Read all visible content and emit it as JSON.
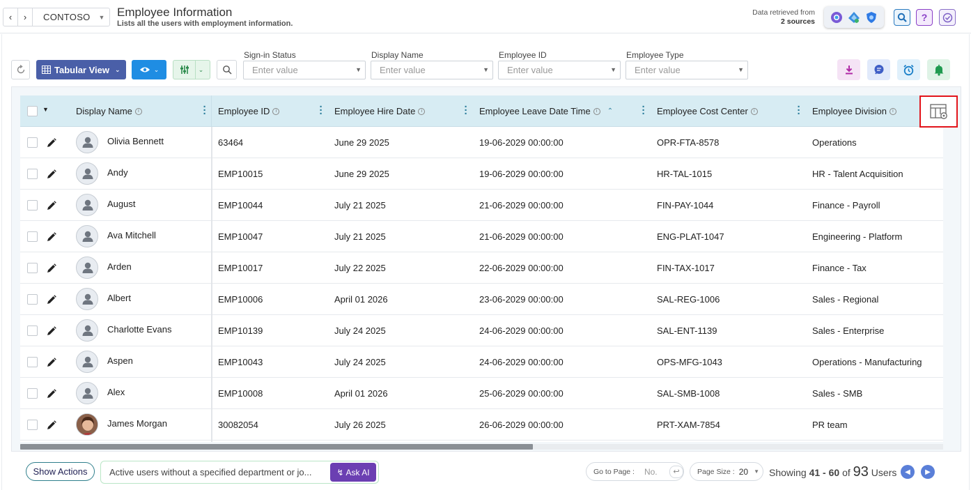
{
  "header": {
    "tenant": "CONTOSO",
    "title": "Employee Information",
    "subtitle": "Lists all the users with employment information.",
    "retrieved_label": "Data retrieved from",
    "retrieved_sources": "2 sources"
  },
  "toolbar": {
    "view_label": "Tabular View",
    "filters": [
      {
        "label": "Sign-in Status",
        "placeholder": "Enter value"
      },
      {
        "label": "Display Name",
        "placeholder": "Enter value"
      },
      {
        "label": "Employee ID",
        "placeholder": "Enter value"
      },
      {
        "label": "Employee Type",
        "placeholder": "Enter value"
      }
    ]
  },
  "table": {
    "columns": [
      "Display Name",
      "Employee ID",
      "Employee Hire Date",
      "Employee Leave Date Time",
      "Employee Cost Center",
      "Employee Division"
    ],
    "sorted_column": "Employee Leave Date Time",
    "sort_direction": "ascending",
    "rows": [
      {
        "name": "Olivia Bennett",
        "id": "63464",
        "hire": "June 29 2025",
        "leave": "19-06-2029 00:00:00",
        "cost": "OPR-FTA-8578",
        "division": "Operations"
      },
      {
        "name": "Andy",
        "id": "EMP10015",
        "hire": "June 29 2025",
        "leave": "19-06-2029 00:00:00",
        "cost": "HR-TAL-1015",
        "division": "HR - Talent Acquisition"
      },
      {
        "name": "August",
        "id": "EMP10044",
        "hire": "July 21 2025",
        "leave": "21-06-2029 00:00:00",
        "cost": "FIN-PAY-1044",
        "division": "Finance - Payroll"
      },
      {
        "name": "Ava Mitchell",
        "id": "EMP10047",
        "hire": "July 21 2025",
        "leave": "21-06-2029 00:00:00",
        "cost": "ENG-PLAT-1047",
        "division": "Engineering - Platform"
      },
      {
        "name": "Arden",
        "id": "EMP10017",
        "hire": "July 22 2025",
        "leave": "22-06-2029 00:00:00",
        "cost": "FIN-TAX-1017",
        "division": "Finance - Tax"
      },
      {
        "name": "Albert",
        "id": "EMP10006",
        "hire": "April 01 2026",
        "leave": "23-06-2029 00:00:00",
        "cost": "SAL-REG-1006",
        "division": "Sales - Regional"
      },
      {
        "name": "Charlotte Evans",
        "id": "EMP10139",
        "hire": "July 24 2025",
        "leave": "24-06-2029 00:00:00",
        "cost": "SAL-ENT-1139",
        "division": "Sales - Enterprise"
      },
      {
        "name": "Aspen",
        "id": "EMP10043",
        "hire": "July 24 2025",
        "leave": "24-06-2029 00:00:00",
        "cost": "OPS-MFG-1043",
        "division": "Operations - Manufacturing"
      },
      {
        "name": "Alex",
        "id": "EMP10008",
        "hire": "April 01 2026",
        "leave": "25-06-2029 00:00:00",
        "cost": "SAL-SMB-1008",
        "division": "Sales - SMB"
      },
      {
        "name": "James Morgan",
        "id": "30082054",
        "hire": "July 26 2025",
        "leave": "26-06-2029 00:00:00",
        "cost": "PRT-XAM-7854",
        "division": "PR team",
        "photo": true
      }
    ]
  },
  "footer": {
    "show_actions": "Show Actions",
    "ai_prompt": "Active users without a specified department or jo...",
    "ask_ai": "Ask AI",
    "goto_label": "Go to Page :",
    "goto_placeholder": "No.",
    "page_size_label": "Page Size :",
    "page_size_value": "20",
    "showing_prefix": "Showing",
    "showing_range": "41 - 60",
    "showing_of": "of",
    "total": "93",
    "unit": "Users"
  },
  "colors": {
    "header_bg": "#d7ecf3",
    "view_btn": "#4a5fa8",
    "ask_ai": "#6b3fb2",
    "highlight": "#e2141b"
  }
}
